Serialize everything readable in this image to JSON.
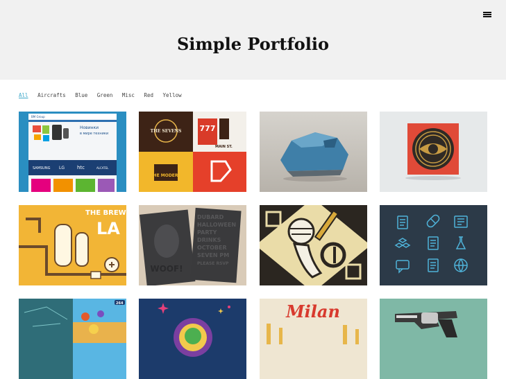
{
  "header": {
    "title": "Simple Portfolio",
    "menu_icon": "hamburger-menu-icon"
  },
  "filters": {
    "items": [
      "All",
      "Aircrafts",
      "Blue",
      "Green",
      "Misc",
      "Red",
      "Yellow"
    ],
    "active": "All"
  },
  "tiles": {
    "t1": {
      "logo": "BM Group",
      "heading_line1": "Новинки",
      "heading_line2": "в мире техники",
      "brand1": "SAMSUNG",
      "brand2": "LG",
      "brand3": "htc",
      "brand4": "ALCATEL"
    },
    "t2": {
      "badge": "THE SEVENS",
      "number": "777",
      "street": "MAIN ST.",
      "sign": "THE MODERN"
    },
    "t3": {},
    "t4": {},
    "t5": {
      "text_line1": "THE BREW",
      "text_line2": "LA"
    },
    "t6": {
      "poster_lines": [
        "DUBARD",
        "HALLOWEEN",
        "PARTY",
        "DRINKS",
        "OCTOBER",
        "SEVEN PM",
        "PLEASE RSVP"
      ],
      "mask_text": "WOOF!"
    },
    "t7": {},
    "t8": {},
    "t9": {
      "score": "264"
    },
    "t10": {},
    "t11": {
      "title": "Milan"
    },
    "t12": {}
  },
  "colors": {
    "accent": "#3aa6c8",
    "header_bg": "#f1f1f1"
  }
}
